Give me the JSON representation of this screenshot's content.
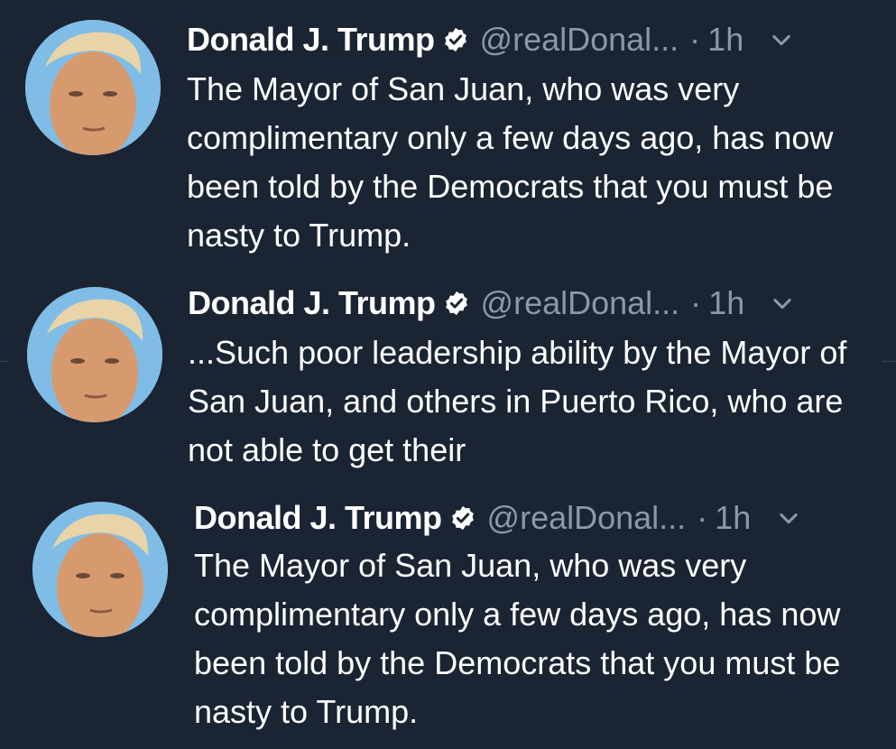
{
  "tweets": [
    {
      "name": "Donald J. Trump",
      "handle": "@realDonal...",
      "separator": "·",
      "time": "1h",
      "text": "The Mayor of San Juan, who was very complimentary only a few days ago, has now been told by the Democrats that you must be nasty to Trump."
    },
    {
      "name": "Donald J. Trump",
      "handle": "@realDonal...",
      "separator": "·",
      "time": "1h",
      "text": "...Such poor leadership ability by the Mayor of San Juan, and others in Puerto Rico, who are not able to get their"
    },
    {
      "name": "Donald J. Trump",
      "handle": "@realDonal...",
      "separator": "·",
      "time": "1h",
      "text": "The Mayor of San Juan, who was very complimentary only a few days ago, has now been told by the Democrats that you must be nasty to Trump."
    }
  ],
  "icons": {
    "verified": "verified-badge-icon",
    "menu": "chevron-down-icon",
    "avatar": "profile-avatar"
  },
  "colors": {
    "background": "#1b2433",
    "text": "#ffffff",
    "muted": "#8b98a8",
    "avatar_bg": "#7fb8e0"
  }
}
